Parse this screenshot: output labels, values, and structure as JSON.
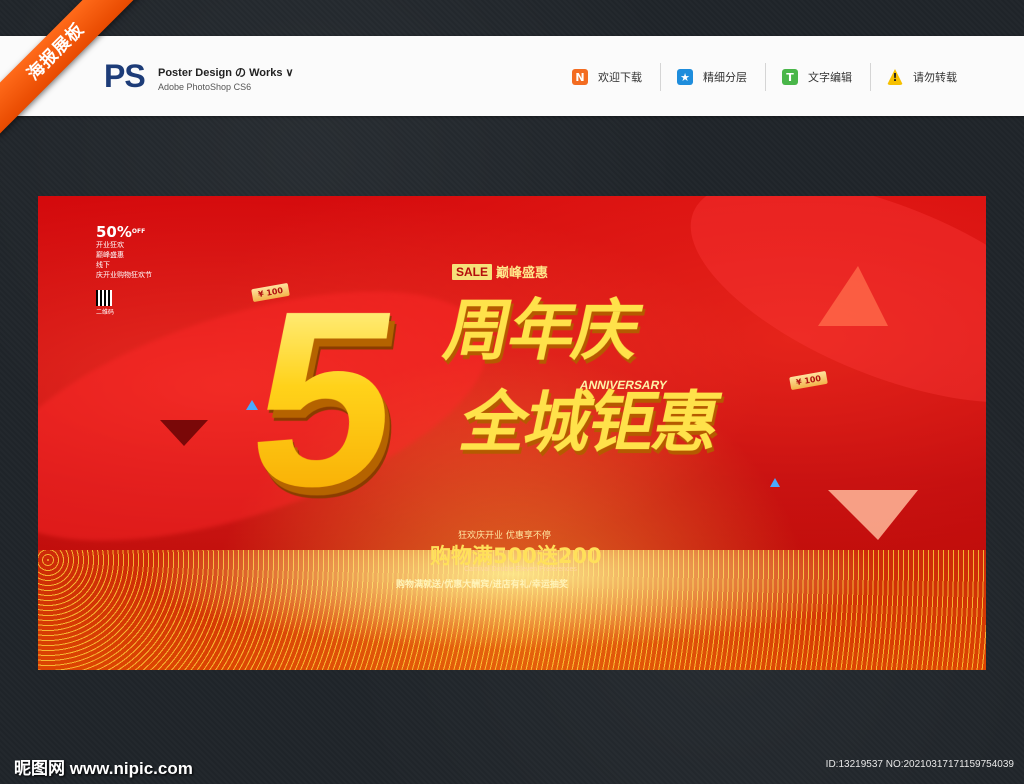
{
  "ribbon": {
    "label": "海报展板"
  },
  "header": {
    "logo": "PS",
    "title": "Poster Design の Works ∨",
    "subtitle": "Adobe PhotoShop CS6",
    "items": [
      {
        "label": "欢迎下载",
        "icon": "n-icon",
        "glyph": "N",
        "color": "#f36c21"
      },
      {
        "label": "精细分层",
        "icon": "star-icon",
        "glyph": "★",
        "color": "#1e8ddc"
      },
      {
        "label": "文字编辑",
        "icon": "text-t-icon",
        "glyph": "T",
        "color": "#49b649"
      },
      {
        "label": "请勿转载",
        "icon": "warning-icon",
        "glyph": "!",
        "color": "#f6c000"
      }
    ]
  },
  "poster": {
    "corner": {
      "percent": "50%",
      "off": "OFF",
      "lines": [
        "开业狂欢",
        "巅峰盛惠",
        "线下",
        "庆开业购物狂欢节"
      ],
      "qr_label": "二维码"
    },
    "sale_tag": "SALE",
    "sale_text": "巅峰盛惠",
    "big_number": "5",
    "title_line1": "周年庆",
    "anniversary": "ANNIVERSARY",
    "title_line2": "全城钜惠",
    "slogan": "狂欢庆开业 优惠享不停",
    "promo": "购物满500送200",
    "english": "Carnival Double Eleven Preferences",
    "perks": "购物满就送/优惠大酬宾/进店有礼/幸运抽奖",
    "price_tags": [
      "¥ 100",
      "¥ 100"
    ]
  },
  "footer": {
    "site": "昵图网 www.nipic.com",
    "id_text": "ID:13219537 NO:20210317171159754039"
  },
  "colors": {
    "accent": "#e84a00",
    "poster_red": "#c8080b",
    "gold": "#ffd21a"
  }
}
